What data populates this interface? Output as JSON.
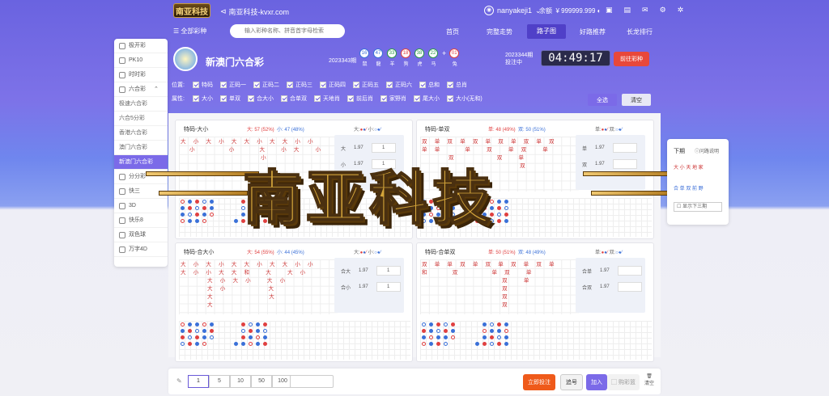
{
  "header": {
    "logo": "南亚科技",
    "site": "南亚科技-kvxr.com",
    "username": "nanyakeji1",
    "balance_label": "余额",
    "balance": "¥ 999999.999"
  },
  "nav": {
    "all_games": "全部彩种",
    "search_placeholder": "输入彩种名称、拼音首字母检索",
    "items": [
      "首页",
      "完整走势",
      "路子图",
      "好路推荐",
      "长龙排行"
    ],
    "active": "路子图"
  },
  "sidebar": [
    "极开彩",
    "PK10",
    "时时彩",
    "六合彩",
    "极速六合彩",
    "六合5分彩",
    "香港六合彩",
    "澳门六合彩",
    "新澳门六合彩",
    "分分彩",
    "快三",
    "3D",
    "快乐8",
    "双色球",
    "万字4D"
  ],
  "lottery": {
    "name": "新澳门六合彩",
    "prev_issue": "2023343期",
    "balls": [
      {
        "n": "16",
        "z": "鼠",
        "c": "#3a70d8"
      },
      {
        "n": "47",
        "z": "龍",
        "c": "#3a70d8"
      },
      {
        "n": "33",
        "z": "羊",
        "c": "#2a9a4a"
      },
      {
        "n": "18",
        "z": "狗",
        "c": "#e04040"
      },
      {
        "n": "38",
        "z": "虎",
        "c": "#2a9a4a"
      },
      {
        "n": "22",
        "z": "马",
        "c": "#2a9a4a"
      },
      {
        "n": "01",
        "z": "兔",
        "c": "#e04040"
      }
    ],
    "cur_issue": "2023344期",
    "cur_status": "投注中",
    "timer": "04:49:17",
    "go_btn": "前往彩种"
  },
  "filters": {
    "pos_label": "位置:",
    "positions": [
      "特码",
      "正码一",
      "正码二",
      "正码三",
      "正码四",
      "正码五",
      "正码六",
      "总和",
      "总肖"
    ],
    "attr_label": "属性:",
    "attrs": [
      "大小",
      "单双",
      "合大小",
      "合单双",
      "天地肖",
      "前后肖",
      "家野肖",
      "尾大小",
      "大小(无和)"
    ],
    "all_btn": "全选",
    "clear_btn": "清空"
  },
  "panels": [
    {
      "title": "特码-大小",
      "s1": "大: 57 (52%)",
      "s2": "小: 47 (48%)",
      "l1": "大:",
      "l2": "小:",
      "bet": [
        {
          "k": "大",
          "o": "1.97",
          "v": "1"
        },
        {
          "k": "小",
          "o": "1.97",
          "v": "1"
        }
      ],
      "grid": "大 小 大 小 大 大 小 大 大 小 小\n  小       小     大   小 大   小\n                  小\n\n\n\n"
    },
    {
      "title": "特码-单双",
      "s1": "单: 48 (49%)",
      "s2": "双: 50 (51%)",
      "l1": "单:",
      "l2": "双:",
      "bet": [
        {
          "k": "单",
          "o": "1.97",
          "v": ""
        },
        {
          "k": "双",
          "o": "1.97",
          "v": ""
        }
      ],
      "grid": "双 单 双 单 双 单 双 单 双 单 双\n单 单     单   双   单 双   单\n      双         双   单\n                      双\n\n"
    },
    {
      "title": "特码-合大小",
      "s1": "大: 54 (55%)",
      "s2": "小: 44 (45%)",
      "l1": "大:",
      "l2": "小:",
      "bet": [
        {
          "k": "合大",
          "o": "1.97",
          "v": "1"
        },
        {
          "k": "合小",
          "o": "1.97",
          "v": "1"
        }
      ],
      "grid": "大 小 大 小 大 大 小 大 大 小 小\n大 小 小 大 大 和   大   大 小\n      大 小 大 小   大 小\n      大 小         大\n      大            大\n      大"
    },
    {
      "title": "特码-合单双",
      "s1": "单: 50 (51%)",
      "s2": "双: 48 (49%)",
      "l1": "单:",
      "l2": "双:",
      "bet": [
        {
          "k": "合单",
          "o": "1.97",
          "v": ""
        },
        {
          "k": "合双",
          "o": "1.97",
          "v": ""
        }
      ],
      "grid": "双 单 单 双 单 双 单 双 单 双 单\n和     双       单 双   单\n                  双   单\n                  双\n                  双\n                  双"
    }
  ],
  "watermark": "南亚科技",
  "right_box": {
    "title": "下期",
    "help": "问路说明",
    "rows": [
      "大  小  天  地  家",
      "合  单  双  前  野"
    ],
    "next3": "显示下三期"
  },
  "footer": {
    "multiples": [
      "1",
      "5",
      "10",
      "50",
      "100"
    ],
    "bet_now": "立即投注",
    "chase": "追号",
    "add": "加入",
    "basket": "购彩篮",
    "clear": "清空"
  }
}
